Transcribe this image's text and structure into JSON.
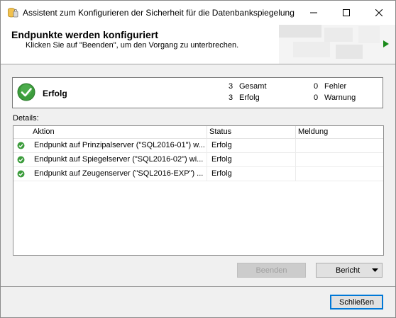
{
  "window": {
    "title": "Assistent zum Konfigurieren der Sicherheit für die Datenbankspiegelung"
  },
  "header": {
    "title": "Endpunkte werden konfiguriert",
    "subtitle": "Klicken Sie auf \"Beenden\", um den Vorgang zu unterbrechen."
  },
  "summary": {
    "status": "Erfolg",
    "total_count": "3",
    "total_label": "Gesamt",
    "success_count": "3",
    "success_label": "Erfolg",
    "error_count": "0",
    "error_label": "Fehler",
    "warning_count": "0",
    "warning_label": "Warnung"
  },
  "details": {
    "label": "Details:",
    "columns": [
      "Aktion",
      "Status",
      "Meldung"
    ],
    "rows": [
      {
        "action": "Endpunkt auf Prinzipalserver (\"SQL2016-01\") w...",
        "status": "Erfolg",
        "message": ""
      },
      {
        "action": "Endpunkt auf Spiegelserver (\"SQL2016-02\") wi...",
        "status": "Erfolg",
        "message": ""
      },
      {
        "action": "Endpunkt auf Zeugenserver (\"SQL2016-EXP\") ...",
        "status": "Erfolg",
        "message": ""
      }
    ]
  },
  "buttons": {
    "stop": "Beenden",
    "report": "Bericht",
    "close": "Schließen"
  },
  "colors": {
    "success": "#3c9c3c",
    "accent": "#0078d7"
  }
}
